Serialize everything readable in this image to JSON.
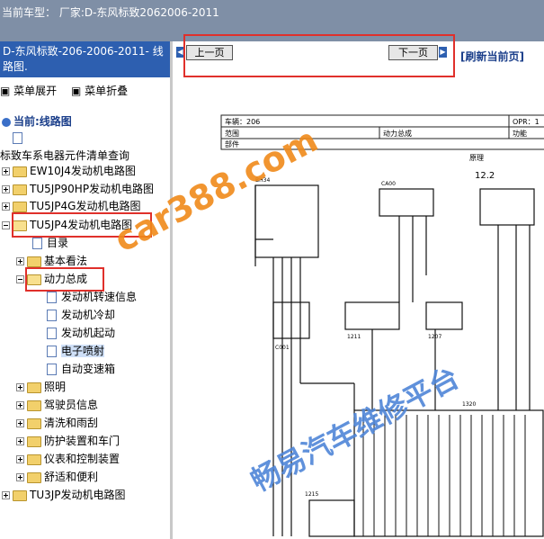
{
  "window": {
    "title": "当前车型： 厂家:D-东风标致2062006-2011"
  },
  "sidebar": {
    "header": "D-东风标致-206-2006-2011- 线路图.",
    "expand_label": "菜单展开",
    "collapse_label": "菜单折叠",
    "current_label": "当前:线路图",
    "items": [
      {
        "label": "标致车系电器元件清单查询"
      },
      {
        "label": "EW10J4发动机电路图"
      },
      {
        "label": "TU5JP90HP发动机电路图"
      },
      {
        "label": "TU5JP4G发动机电路图"
      },
      {
        "label": "TU5JP4发动机电路图"
      },
      {
        "label": "目录"
      },
      {
        "label": "基本看法"
      },
      {
        "label": "动力总成"
      },
      {
        "label": "发动机转速信息"
      },
      {
        "label": "发动机冷却"
      },
      {
        "label": "发动机起动"
      },
      {
        "label": "电子喷射"
      },
      {
        "label": "自动变速箱"
      },
      {
        "label": "照明"
      },
      {
        "label": "驾驶员信息"
      },
      {
        "label": "清洗和雨刮"
      },
      {
        "label": "防护装置和车门"
      },
      {
        "label": "仪表和控制装置"
      },
      {
        "label": "舒适和便利"
      },
      {
        "label": "TU3JP发动机电路图"
      }
    ]
  },
  "nav": {
    "prev_label": "上一页",
    "next_label": "下一页",
    "refresh_label": "[刷新当前页]"
  },
  "document": {
    "header_row1_left": "车辆：206",
    "header_row1_right": "OPR：1",
    "header_row2_left": "范围",
    "header_row2_mid": "动力总成",
    "header_row2_right": "功能",
    "header_row3_left": "部件",
    "section_label": "原理",
    "sub_label": "12.2",
    "labels": [
      "BH34",
      "CA00",
      "C001",
      "1211",
      "1207",
      "1215",
      "1320"
    ]
  },
  "watermarks": {
    "site": "car388.com",
    "brand": "畅易汽车维修平台"
  }
}
